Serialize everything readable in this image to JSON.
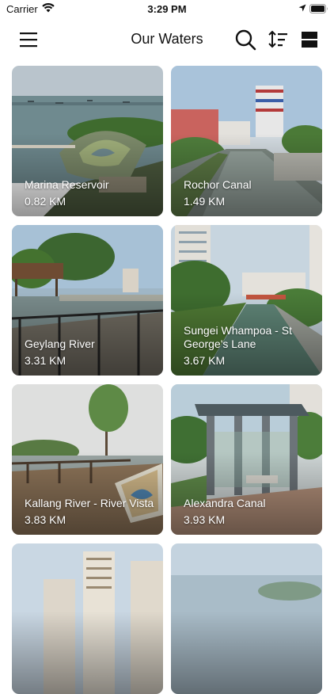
{
  "status_bar": {
    "carrier": "Carrier",
    "time": "3:29 PM",
    "icons": [
      "wifi-icon",
      "location-arrow-icon",
      "battery-icon"
    ]
  },
  "nav": {
    "title": "Our Waters",
    "icons": [
      "hamburger-menu-icon",
      "search-icon",
      "sort-icon",
      "grid-layout-icon"
    ]
  },
  "waters": [
    {
      "name": "Marina Reservoir",
      "distance": "0.82 KM"
    },
    {
      "name": "Rochor Canal",
      "distance": "1.49 KM"
    },
    {
      "name": "Geylang River",
      "distance": "3.31 KM"
    },
    {
      "name": "Sungei Whampoa - St George's Lane",
      "distance": "3.67 KM"
    },
    {
      "name": "Kallang River - River Vista",
      "distance": "3.83 KM"
    },
    {
      "name": "Alexandra Canal",
      "distance": "3.93 KM"
    },
    {
      "name": "",
      "distance": ""
    },
    {
      "name": "",
      "distance": ""
    }
  ],
  "colors": {
    "text": "#111111",
    "card_label": "#ffffff",
    "background": "#ffffff"
  }
}
